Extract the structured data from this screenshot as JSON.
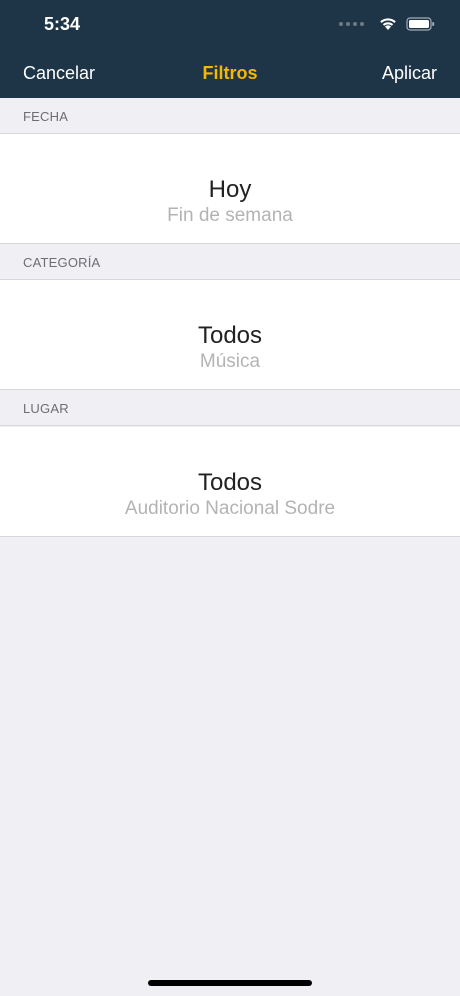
{
  "status": {
    "time": "5:34",
    "icons": [
      "signal-dots-icon",
      "wifi-icon",
      "battery-icon"
    ]
  },
  "nav": {
    "cancel_label": "Cancelar",
    "title": "Filtros",
    "apply_label": "Aplicar",
    "title_color": "#f5b800",
    "bar_color": "#1e3447"
  },
  "sections": {
    "fecha": {
      "header": "FECHA",
      "selected": "Hoy",
      "next": "Fin de semana"
    },
    "categoria": {
      "header": "CATEGORÍA",
      "selected": "Todos",
      "next": "Música"
    },
    "lugar": {
      "header": "LUGAR",
      "selected": "Todos",
      "next": "Auditorio Nacional Sodre"
    }
  }
}
